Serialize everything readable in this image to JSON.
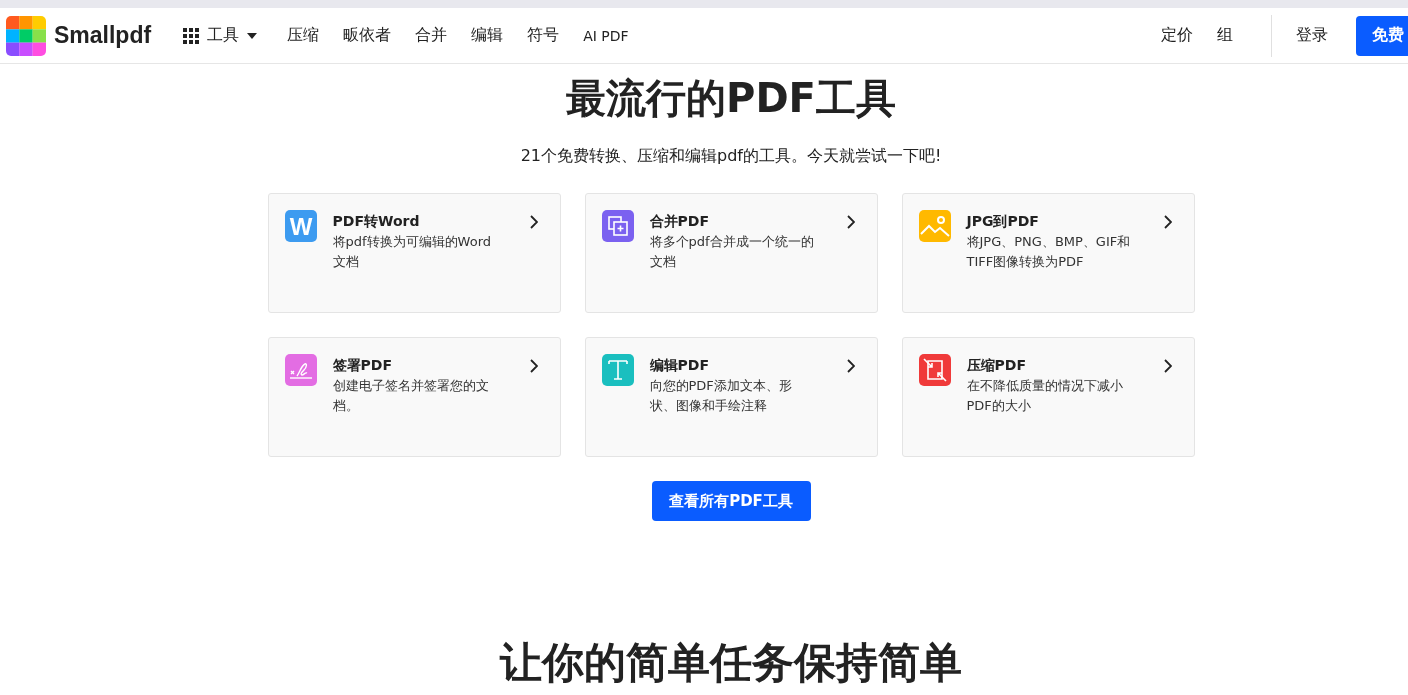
{
  "header": {
    "logo": "Smallpdf",
    "tools_menu": "工具",
    "nav": [
      "压缩",
      "畈依者",
      "合并",
      "编辑",
      "符号",
      "AI PDF"
    ],
    "right_links": [
      "定价",
      "组"
    ],
    "login": "登录",
    "cta": "免费"
  },
  "hero": {
    "title": "最流行的PDF工具",
    "subtitle": "21个免费转换、压缩和编辑pdf的工具。今天就尝试一下吧!"
  },
  "tools": [
    {
      "kind": "word",
      "icon_text": "W",
      "color": "#3d9bf0",
      "title": "PDF转Word",
      "description": "将pdf转换为可编辑的Word文档"
    },
    {
      "kind": "merge",
      "color": "#7b61f0",
      "title": "合并PDF",
      "description": "将多个pdf合并成一个统一的文档"
    },
    {
      "kind": "image",
      "color": "#ffb900",
      "title": "JPG到PDF",
      "description": "将JPG、PNG、BMP、GIF和TIFF图像转换为PDF"
    },
    {
      "kind": "sign",
      "color": "#e36de3",
      "title": "签署PDF",
      "description": "创建电子签名并签署您的文档。"
    },
    {
      "kind": "edit",
      "color": "#1abfbf",
      "title": "编辑PDF",
      "description": "向您的PDF添加文本、形状、图像和手绘注释"
    },
    {
      "kind": "compress",
      "color": "#f03a3a",
      "title": "压缩PDF",
      "description": "在不降低质量的情况下减小PDF的大小"
    }
  ],
  "all_tools_button": "查看所有PDF工具",
  "next_section": {
    "title": "让你的简单任务保持简单"
  }
}
